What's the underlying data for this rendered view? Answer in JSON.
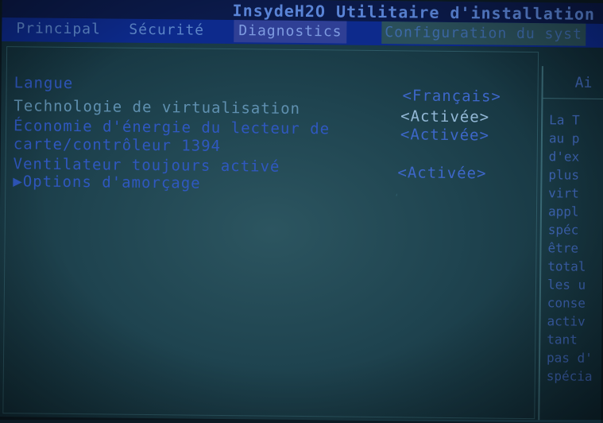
{
  "app": {
    "title": "InsydeH2O Utilitaire d'installation"
  },
  "menu": [
    {
      "label": "Principal",
      "active": false
    },
    {
      "label": "Sécurité",
      "active": false
    },
    {
      "label": "Diagnostics",
      "active": true
    },
    {
      "label": "Configuration du syst",
      "active": false
    }
  ],
  "settings": [
    {
      "label": "Langue",
      "value": "<Français>"
    },
    {
      "label": "Technologie de virtualisation",
      "value": "<Activée>"
    },
    {
      "label_line1": "Économie d'énergie du lecteur de",
      "label_line2": "carte/contrôleur 1394",
      "value": "<Activée>"
    },
    {
      "label": "Ventilateur toujours activé",
      "value": "<Activée>"
    },
    {
      "label": "▶Options d'amorçage"
    }
  ],
  "help": {
    "header": "Ai",
    "lines": [
      "La T",
      "au p",
      "d'ex",
      "plus",
      "virt",
      "appl",
      "spéc",
      "être",
      "total",
      "les u",
      "conse",
      "activ",
      "tant",
      "pas d'",
      "spécia"
    ]
  },
  "colors": {
    "title_bar": "#0b1a4a",
    "menu_bar": "#0d2a8c",
    "menu_active": "#2f3f95",
    "panel_bg": "#1f4450",
    "text_blue": "#2f58c0",
    "text_highlight": "#93b8d6"
  }
}
